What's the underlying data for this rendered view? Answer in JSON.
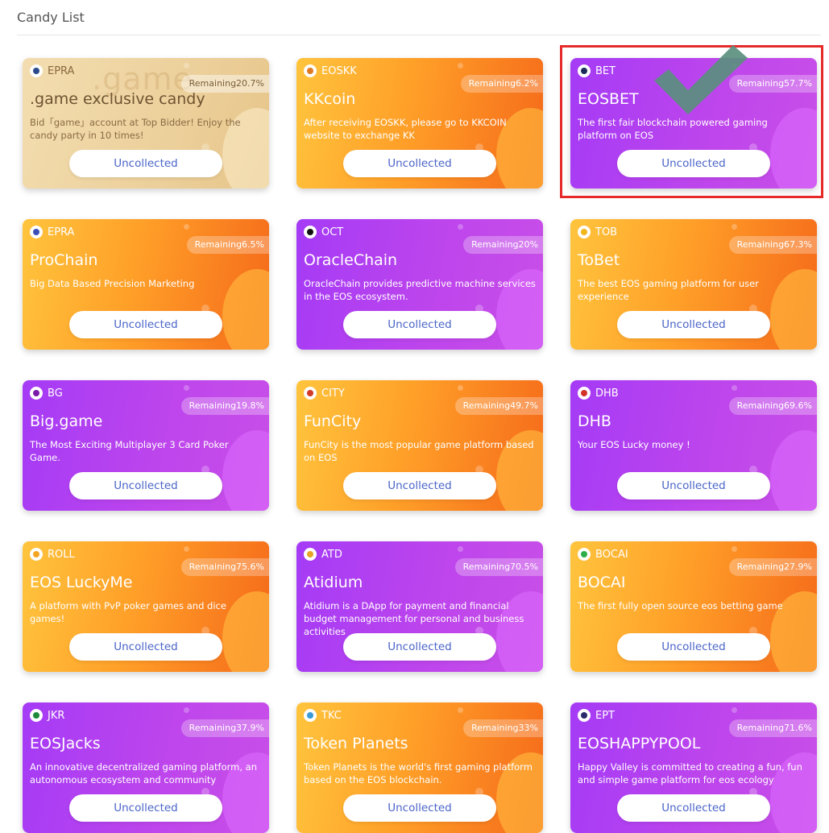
{
  "header": {
    "title": "Candy List"
  },
  "cards": [
    {
      "tag": "EPRA",
      "remaining": "Remaining20.7%",
      "name": ".game exclusive candy",
      "desc": "Bid「game」account at Top Bidder! Enjoy the candy party in 10 times!",
      "button": "Uncollected",
      "theme": "gold",
      "watermark": ".game",
      "icon_color": "#2a4a8a",
      "icon": "eye-icon"
    },
    {
      "tag": "EOSKK",
      "remaining": "Remaining6.2%",
      "name": "KKcoin",
      "desc": "After receiving EOSKK, please go to KKCOIN website to exchange KK",
      "button": "Uncollected",
      "theme": "orange",
      "icon_color": "#e07a22",
      "icon": "kk-icon"
    },
    {
      "tag": "BET",
      "remaining": "Remaining57.7%",
      "name": "EOSBET",
      "desc": "The first fair blockchain powered gaming platform on EOS",
      "button": "Uncollected",
      "theme": "purple",
      "icon_color": "#1c2a5a",
      "icon": "eosbet-icon"
    },
    {
      "tag": "EPRA",
      "remaining": "Remaining6.5%",
      "name": "ProChain",
      "desc": "Big Data Based Precision Marketing",
      "button": "Uncollected",
      "theme": "orange",
      "icon_color": "#3c4fb8",
      "icon": "prochain-icon"
    },
    {
      "tag": "OCT",
      "remaining": "Remaining20%",
      "name": "OracleChain",
      "desc": "OracleChain provides predictive machine services in the EOS ecosystem.",
      "button": "Uncollected",
      "theme": "purple",
      "icon_color": "#111111",
      "icon": "oraclechain-icon"
    },
    {
      "tag": "TOB",
      "remaining": "Remaining67.3%",
      "name": "ToBet",
      "desc": "The best EOS gaming platform for user experience",
      "button": "Uncollected",
      "theme": "orange",
      "icon_color": "#f2b51a",
      "icon": "tobet-icon"
    },
    {
      "tag": "BG",
      "remaining": "Remaining19.8%",
      "name": "Big.game",
      "desc": "The Most Exciting Multiplayer 3 Card Poker Game.",
      "button": "Uncollected",
      "theme": "purple",
      "icon_color": "#7a1aa8",
      "icon": "biggame-icon"
    },
    {
      "tag": "CITY",
      "remaining": "Remaining49.7%",
      "name": "FunCity",
      "desc": "FunCity is the most popular game platform based on EOS",
      "button": "Uncollected",
      "theme": "orange",
      "icon_color": "#d23a2a",
      "icon": "funcity-icon"
    },
    {
      "tag": "DHB",
      "remaining": "Remaining69.6%",
      "name": "DHB",
      "desc": "Your EOS Lucky money !",
      "button": "Uncollected",
      "theme": "purple",
      "icon_color": "#d2322a",
      "icon": "dhb-icon"
    },
    {
      "tag": "ROLL",
      "remaining": "Remaining75.6%",
      "name": "EOS LuckyMe",
      "desc": "A platform with PvP poker games and dice games!",
      "button": "Uncollected",
      "theme": "orange",
      "icon_color": "#f5a524",
      "icon": "luckyme-icon"
    },
    {
      "tag": "ATD",
      "remaining": "Remaining70.5%",
      "name": "Atidium",
      "desc": "Atidium is a DApp for payment and financial budget management for personal and business activities",
      "button": "Uncollected",
      "theme": "purple",
      "icon_color": "#e7a425",
      "icon": "atidium-icon"
    },
    {
      "tag": "BOCAI",
      "remaining": "Remaining27.9%",
      "name": "BOCAI",
      "desc": "The first fully open source eos betting game",
      "button": "Uncollected",
      "theme": "orange",
      "icon_color": "#2cae4a",
      "icon": "bocai-icon"
    },
    {
      "tag": "JKR",
      "remaining": "Remaining37.9%",
      "name": "EOSJacks",
      "desc": "An innovative decentralized gaming platform, an autonomous ecosystem and community",
      "button": "Uncollected",
      "theme": "purple",
      "icon_color": "#1e8a3a",
      "icon": "eosjacks-icon"
    },
    {
      "tag": "TKC",
      "remaining": "Remaining33%",
      "name": "Token Planets",
      "desc": "Token Planets is the world's first gaming platform based on the EOS blockchain.",
      "button": "Uncollected",
      "theme": "orange",
      "icon_color": "#3a9ad8",
      "icon": "tokenplanets-icon"
    },
    {
      "tag": "EPT",
      "remaining": "Remaining71.6%",
      "name": "EOSHAPPYPOOL",
      "desc": "Happy Valley is committed to creating a fun, fun and simple game platform for eos ecology",
      "button": "Uncollected",
      "theme": "purple",
      "icon_color": "#2a2a6a",
      "icon": "happypool-icon"
    }
  ]
}
